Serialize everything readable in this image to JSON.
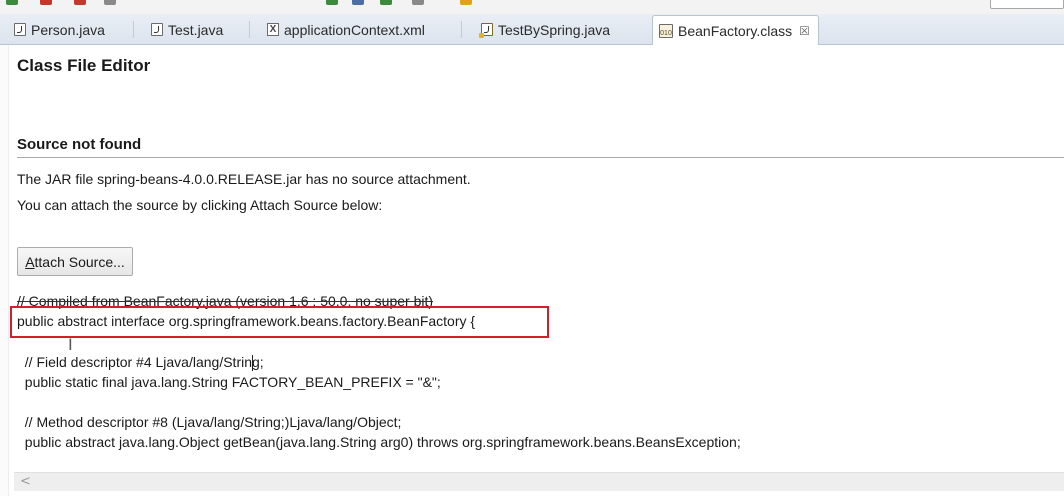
{
  "tabs": [
    {
      "label": "Person.java",
      "icon": "java-file-icon"
    },
    {
      "label": "Test.java",
      "icon": "java-file-icon"
    },
    {
      "label": "applicationContext.xml",
      "icon": "xml-file-icon"
    },
    {
      "label": "TestBySpring.java",
      "icon": "java-file-warning-icon"
    },
    {
      "label": "BeanFactory.class",
      "icon": "class-file-icon",
      "active": true,
      "close": "☒"
    }
  ],
  "editor": {
    "title": "Class File Editor",
    "section_title": "Source not found",
    "message_1": "The JAR file spring-beans-4.0.0.RELEASE.jar has no source attachment.",
    "message_2": "You can attach the source by clicking Attach Source below:",
    "attach_button": {
      "mnemonic": "A",
      "rest": "ttach Source..."
    }
  },
  "code_lines": [
    "// Compiled from BeanFactory.java (version 1.6 : 50.0, no super bit)",
    "public abstract interface org.springframework.beans.factory.BeanFactory {",
    "  // Field descriptor #4 Ljava/lang/String;",
    "  public static final java.lang.String FACTORY_BEAN_PREFIX = \"&\";",
    "  // Method descriptor #8 (Ljava/lang/String;)Ljava/lang/Object;",
    "  public abstract java.lang.Object getBean(java.lang.String arg0) throws org.springframework.beans.BeansException;"
  ],
  "colors": {
    "highlight": "#d11f2c"
  }
}
